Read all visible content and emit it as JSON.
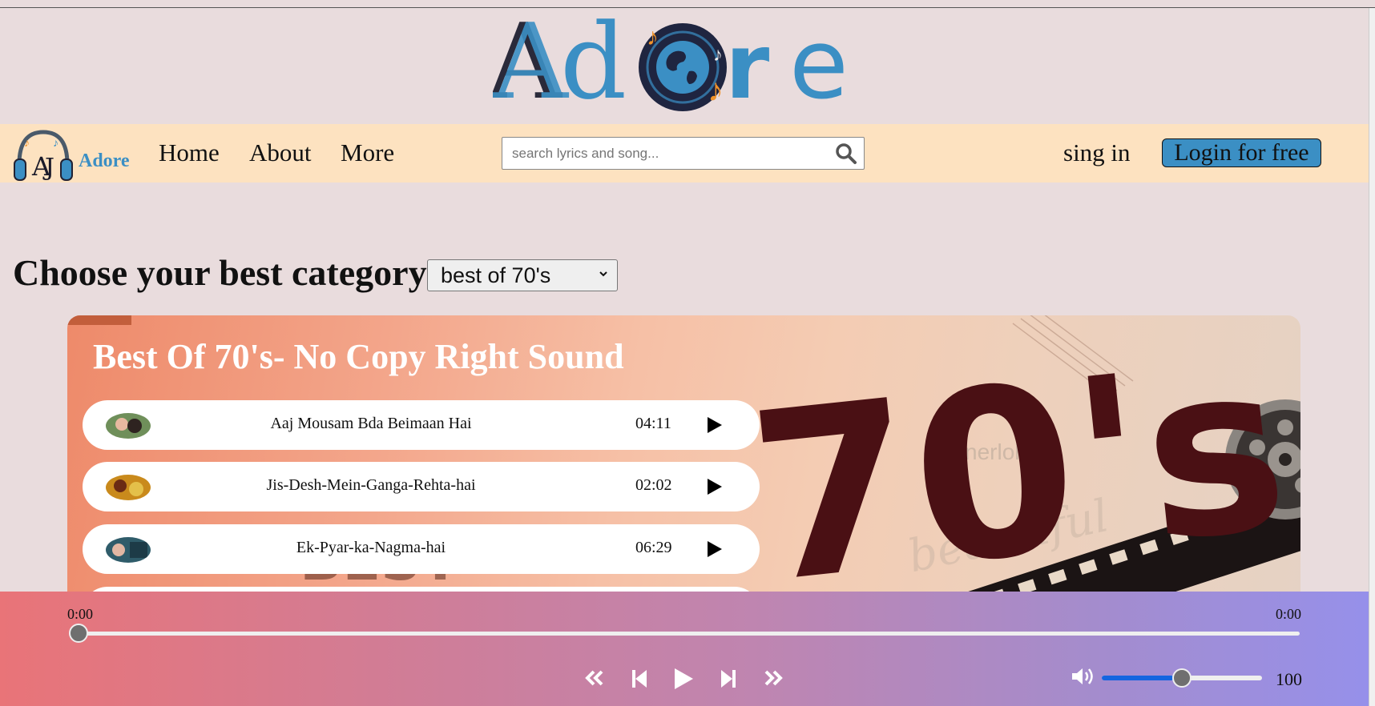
{
  "brand": {
    "name": "Adore"
  },
  "nav": {
    "logo_text": "Adore",
    "links": [
      "Home",
      "About",
      "More"
    ],
    "search_placeholder": "search lyrics and song...",
    "signin_label": "sing in",
    "login_label": "Login for free"
  },
  "category": {
    "heading": "Choose your best category",
    "selected": "best of 70's"
  },
  "playlist": {
    "title": "Best Of 70's- No Copy Right Sound",
    "banner_text": "70's",
    "songs": [
      {
        "title": "Aaj Mousam Bda Beimaan Hai",
        "duration": "04:11"
      },
      {
        "title": "Jis-Desh-Mein-Ganga-Rehta-hai",
        "duration": "02:02"
      },
      {
        "title": "Ek-Pyar-ka-Nagma-hai",
        "duration": "06:29"
      }
    ]
  },
  "player": {
    "current_time": "0:00",
    "total_time": "0:00",
    "progress": 0,
    "volume": 100,
    "volume_fraction": 0.45
  },
  "colors": {
    "accent": "#3b8fc4",
    "navbar_bg": "#fde2c0",
    "page_bg": "#e9dcdd",
    "volume_fill": "#1565e0"
  }
}
